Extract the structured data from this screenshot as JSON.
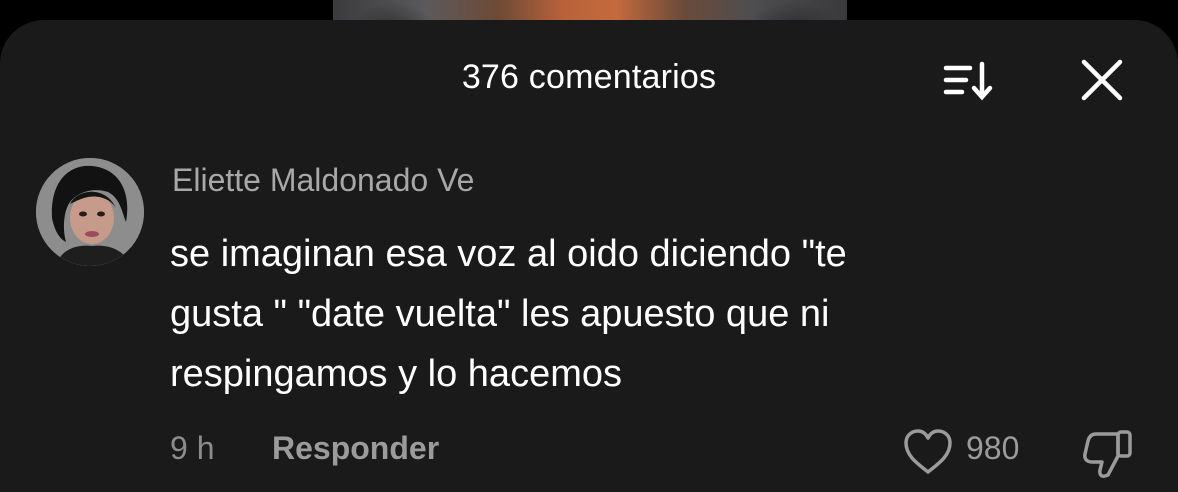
{
  "header": {
    "title": "376 comentarios",
    "sort_icon": "sort-icon",
    "close_icon": "close-icon"
  },
  "comment": {
    "username": "Eliette Maldonado Ve",
    "lines": [
      "se imaginan esa voz al oido diciendo \"te",
      "gusta \" \"date vuelta\" les apuesto que ni",
      "respingamos y lo hacemos"
    ],
    "time": "9 h",
    "reply_label": "Responder",
    "like_count": "980",
    "like_icon": "heart-icon",
    "dislike_icon": "thumbs-down-icon"
  },
  "colors": {
    "background": "#000000",
    "sheet": "#1a1a1a",
    "primary_text": "#ffffff",
    "secondary_text": "#a8a8a8"
  }
}
